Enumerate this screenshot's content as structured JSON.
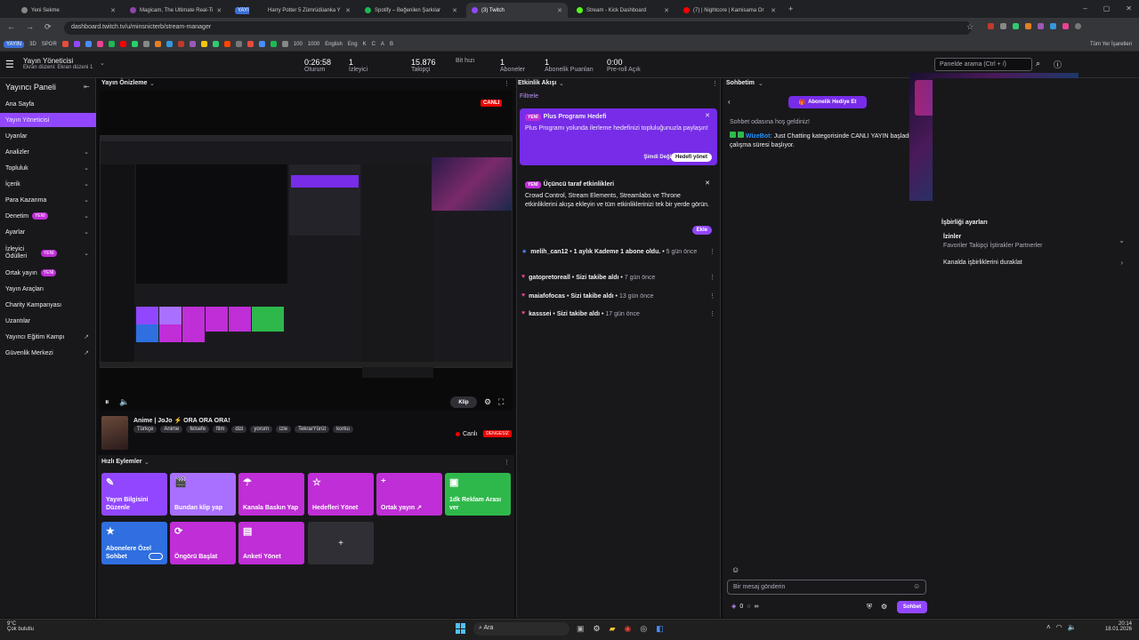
{
  "browser": {
    "tabs": [
      {
        "label": "Yeni Sekme",
        "color": "#888888"
      },
      {
        "label": "Magicam, The Ultimate Real-Ti",
        "color": "#8e44ad"
      },
      {
        "label": "YAYIN",
        "color": "#3b6fd6"
      },
      {
        "label": "Harry Potter 5 Zümrüdüanka Y",
        "color": "#222222"
      },
      {
        "label": "Spotify – Beğenilen Şarkılar",
        "color": "#1db954"
      },
      {
        "label": "(3) Twitch",
        "color": "#9147ff"
      },
      {
        "label": "Stream - Kick Dashboard",
        "color": "#53fc18"
      },
      {
        "label": "(7) | Nightcore | Kamisama Or",
        "color": "#ff0000"
      }
    ],
    "url": "dashboard.twitch.tv/u/minsnicterb/stream-manager",
    "bookmarks": [
      "YAYIN",
      "3D",
      "SPOR",
      "100",
      "1000",
      "English",
      "Eng",
      "K",
      "C",
      "A",
      "B"
    ],
    "all_bookmarks": "Tüm Yer İşaretleri"
  },
  "topbar": {
    "title": "Yayın Yöneticisi",
    "subtitle": "Ekran düzeni: Ekran düzeni 1",
    "stats": [
      {
        "value": "0:26:58",
        "label": "Oturum"
      },
      {
        "value": "1",
        "label": "İzleyici"
      },
      {
        "value": "15.876",
        "label": "Takipçi"
      },
      {
        "value": "",
        "label": "Bit hızı"
      },
      {
        "value": "1",
        "label": "Aboneler"
      },
      {
        "value": "1",
        "label": "Abonelik Puanları"
      },
      {
        "value": "0:00",
        "label": "Pre-roll Açık"
      }
    ],
    "search_placeholder": "Panelde arama (Ctrl + /)"
  },
  "sidebar": {
    "title": "Yayıncı Paneli",
    "items": [
      {
        "label": "Ana Sayfa",
        "new": "",
        "chevron": false
      },
      {
        "label": "Yayın Yöneticisi",
        "new": "",
        "chevron": false
      },
      {
        "label": "Uyarılar",
        "new": "",
        "chevron": false
      },
      {
        "label": "Analizler",
        "new": "",
        "chevron": true
      },
      {
        "label": "Topluluk",
        "new": "",
        "chevron": true
      },
      {
        "label": "İçerik",
        "new": "",
        "chevron": true
      },
      {
        "label": "Para Kazanma",
        "new": "",
        "chevron": true
      },
      {
        "label": "Denetim",
        "new": "YENİ",
        "chevron": true
      },
      {
        "label": "Ayarlar",
        "new": "",
        "chevron": true
      },
      {
        "label": "İzleyici Ödülleri",
        "new": "YENİ",
        "chevron": true
      },
      {
        "label": "Ortak yayın",
        "new": "YENİ",
        "chevron": false
      },
      {
        "label": "Yayın Araçları",
        "new": "",
        "chevron": false
      },
      {
        "label": "Charity Kampanyası",
        "new": "",
        "chevron": false
      },
      {
        "label": "Uzantılar",
        "new": "",
        "chevron": false
      },
      {
        "label": "Yayıncı Eğitim Kampı",
        "new": "",
        "chevron": false
      },
      {
        "label": "Güvenlik Merkezi",
        "new": "",
        "chevron": false
      }
    ]
  },
  "preview": {
    "title": "Yayın Önizleme",
    "live_badge": "CANLI",
    "clip_label": "Klip",
    "stream_title": "Anime | JoJo ⚡ ORA ORA ORA!",
    "tags": [
      "Türkçe",
      "Anime",
      "felsefe",
      "film",
      "dizi",
      "yorum",
      "izle",
      "TekrarYürüt",
      "korku"
    ],
    "live_text": "Canlı",
    "quality": "DENGESİZ"
  },
  "quick_actions": {
    "title": "Hızlı Eylemler",
    "items": [
      {
        "label": "Yayın Bilgisini Düzenle",
        "icon": "✎",
        "color": "#9147ff"
      },
      {
        "label": "Bundan klip yap",
        "icon": "🎬",
        "color": "#a970ff"
      },
      {
        "label": "Kanala Baskın Yap",
        "icon": "☂",
        "color": "#bf2ed6"
      },
      {
        "label": "Hedefleri Yönet",
        "icon": "☆",
        "color": "#bf2ed6"
      },
      {
        "label": "Ortak yayın ↗",
        "icon": "⁺",
        "color": "#bf2ed6"
      },
      {
        "label": "1dk Reklam Arası ver",
        "icon": "▣",
        "color": "#2eb84b"
      },
      {
        "label": "Abonelere Özel Sohbet",
        "icon": "★",
        "color": "#2f6fe0"
      },
      {
        "label": "Öngörü Başlat",
        "icon": "⟳",
        "color": "#bf2ed6"
      },
      {
        "label": "Anketi Yönet",
        "icon": "▤",
        "color": "#bf2ed6"
      }
    ],
    "add": "+"
  },
  "activity": {
    "title": "Etkinlik Akışı",
    "filter": "Filtrele",
    "plus_card": {
      "badge": "YENİ",
      "title": "Plus Programı Hedefi",
      "text": "Plus Programı yolunda ilerleme hedefinizi topluluğunuzla paylaşın!",
      "later": "Şimdi Değil",
      "manage": "Hedefi yönet"
    },
    "third_card": {
      "badge": "YENİ",
      "title": "Üçüncü taraf etkinlikleri",
      "text": "Crowd Control, Stream Elements, Streamlabs ve Throne etkinliklerini akışa ekleyin ve tüm etkinliklerinizi tek bir yerde görün.",
      "add": "Ekle"
    },
    "feed": [
      {
        "user": "melih_can12",
        "text": "1 aylık Kademe 1 abone oldu.",
        "ago": "5 gün önce",
        "icon": "★"
      },
      {
        "user": "gatopretoreall",
        "text": "Sizi takibe aldı",
        "ago": "7 gün önce",
        "icon": "♥"
      },
      {
        "user": "maiafofocas",
        "text": "Sizi takibe aldı",
        "ago": "13 gün önce",
        "icon": "♥"
      },
      {
        "user": "kasssei",
        "text": "Sizi takibe aldı",
        "ago": "17 gün önce",
        "icon": "♥"
      }
    ]
  },
  "chat": {
    "title": "Sohbetim",
    "gift": "Abonelik Hediye Et",
    "welcome": "Sohbet odasına hoş geldiniz!",
    "bot_name": "WizeBot:",
    "bot_msg": "Just Chatting kategorisinde CANLI YAYIN başladı, çalışma süresi başlıyor.",
    "input_placeholder": "Bir mesaj gönderin",
    "points": "0",
    "infinity": "∞",
    "send": "Sohbet"
  },
  "collab": {
    "title": "İşbirliği ayarları",
    "perm_title": "İzinler",
    "perm_sub": "Favoriler Takipçi İştirakler Partnerler",
    "pause": "Kanalda işbirliklerini duraklat"
  },
  "taskbar": {
    "weather_temp": "9°C",
    "weather_desc": "Çok bulutlu",
    "search": "Ara",
    "time": "20:14",
    "date": "18.01.2026"
  }
}
